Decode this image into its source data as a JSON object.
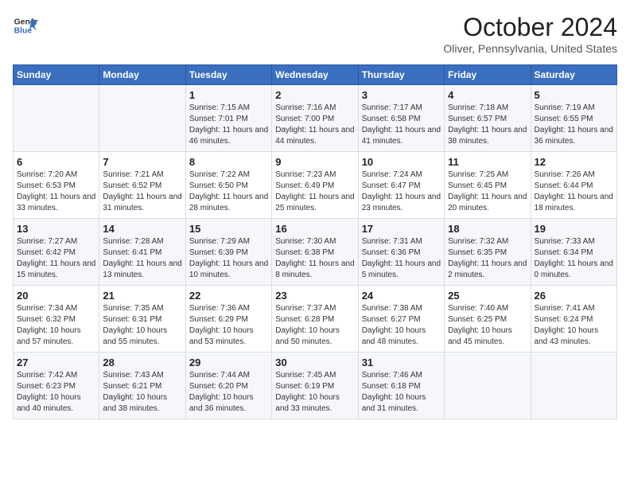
{
  "logo": {
    "line1": "General",
    "line2": "Blue"
  },
  "title": "October 2024",
  "location": "Oliver, Pennsylvania, United States",
  "days_header": [
    "Sunday",
    "Monday",
    "Tuesday",
    "Wednesday",
    "Thursday",
    "Friday",
    "Saturday"
  ],
  "weeks": [
    [
      {
        "day": "",
        "content": ""
      },
      {
        "day": "",
        "content": ""
      },
      {
        "day": "1",
        "content": "Sunrise: 7:15 AM\nSunset: 7:01 PM\nDaylight: 11 hours and 46 minutes."
      },
      {
        "day": "2",
        "content": "Sunrise: 7:16 AM\nSunset: 7:00 PM\nDaylight: 11 hours and 44 minutes."
      },
      {
        "day": "3",
        "content": "Sunrise: 7:17 AM\nSunset: 6:58 PM\nDaylight: 11 hours and 41 minutes."
      },
      {
        "day": "4",
        "content": "Sunrise: 7:18 AM\nSunset: 6:57 PM\nDaylight: 11 hours and 38 minutes."
      },
      {
        "day": "5",
        "content": "Sunrise: 7:19 AM\nSunset: 6:55 PM\nDaylight: 11 hours and 36 minutes."
      }
    ],
    [
      {
        "day": "6",
        "content": "Sunrise: 7:20 AM\nSunset: 6:53 PM\nDaylight: 11 hours and 33 minutes."
      },
      {
        "day": "7",
        "content": "Sunrise: 7:21 AM\nSunset: 6:52 PM\nDaylight: 11 hours and 31 minutes."
      },
      {
        "day": "8",
        "content": "Sunrise: 7:22 AM\nSunset: 6:50 PM\nDaylight: 11 hours and 28 minutes."
      },
      {
        "day": "9",
        "content": "Sunrise: 7:23 AM\nSunset: 6:49 PM\nDaylight: 11 hours and 25 minutes."
      },
      {
        "day": "10",
        "content": "Sunrise: 7:24 AM\nSunset: 6:47 PM\nDaylight: 11 hours and 23 minutes."
      },
      {
        "day": "11",
        "content": "Sunrise: 7:25 AM\nSunset: 6:45 PM\nDaylight: 11 hours and 20 minutes."
      },
      {
        "day": "12",
        "content": "Sunrise: 7:26 AM\nSunset: 6:44 PM\nDaylight: 11 hours and 18 minutes."
      }
    ],
    [
      {
        "day": "13",
        "content": "Sunrise: 7:27 AM\nSunset: 6:42 PM\nDaylight: 11 hours and 15 minutes."
      },
      {
        "day": "14",
        "content": "Sunrise: 7:28 AM\nSunset: 6:41 PM\nDaylight: 11 hours and 13 minutes."
      },
      {
        "day": "15",
        "content": "Sunrise: 7:29 AM\nSunset: 6:39 PM\nDaylight: 11 hours and 10 minutes."
      },
      {
        "day": "16",
        "content": "Sunrise: 7:30 AM\nSunset: 6:38 PM\nDaylight: 11 hours and 8 minutes."
      },
      {
        "day": "17",
        "content": "Sunrise: 7:31 AM\nSunset: 6:36 PM\nDaylight: 11 hours and 5 minutes."
      },
      {
        "day": "18",
        "content": "Sunrise: 7:32 AM\nSunset: 6:35 PM\nDaylight: 11 hours and 2 minutes."
      },
      {
        "day": "19",
        "content": "Sunrise: 7:33 AM\nSunset: 6:34 PM\nDaylight: 11 hours and 0 minutes."
      }
    ],
    [
      {
        "day": "20",
        "content": "Sunrise: 7:34 AM\nSunset: 6:32 PM\nDaylight: 10 hours and 57 minutes."
      },
      {
        "day": "21",
        "content": "Sunrise: 7:35 AM\nSunset: 6:31 PM\nDaylight: 10 hours and 55 minutes."
      },
      {
        "day": "22",
        "content": "Sunrise: 7:36 AM\nSunset: 6:29 PM\nDaylight: 10 hours and 53 minutes."
      },
      {
        "day": "23",
        "content": "Sunrise: 7:37 AM\nSunset: 6:28 PM\nDaylight: 10 hours and 50 minutes."
      },
      {
        "day": "24",
        "content": "Sunrise: 7:38 AM\nSunset: 6:27 PM\nDaylight: 10 hours and 48 minutes."
      },
      {
        "day": "25",
        "content": "Sunrise: 7:40 AM\nSunset: 6:25 PM\nDaylight: 10 hours and 45 minutes."
      },
      {
        "day": "26",
        "content": "Sunrise: 7:41 AM\nSunset: 6:24 PM\nDaylight: 10 hours and 43 minutes."
      }
    ],
    [
      {
        "day": "27",
        "content": "Sunrise: 7:42 AM\nSunset: 6:23 PM\nDaylight: 10 hours and 40 minutes."
      },
      {
        "day": "28",
        "content": "Sunrise: 7:43 AM\nSunset: 6:21 PM\nDaylight: 10 hours and 38 minutes."
      },
      {
        "day": "29",
        "content": "Sunrise: 7:44 AM\nSunset: 6:20 PM\nDaylight: 10 hours and 36 minutes."
      },
      {
        "day": "30",
        "content": "Sunrise: 7:45 AM\nSunset: 6:19 PM\nDaylight: 10 hours and 33 minutes."
      },
      {
        "day": "31",
        "content": "Sunrise: 7:46 AM\nSunset: 6:18 PM\nDaylight: 10 hours and 31 minutes."
      },
      {
        "day": "",
        "content": ""
      },
      {
        "day": "",
        "content": ""
      }
    ]
  ]
}
